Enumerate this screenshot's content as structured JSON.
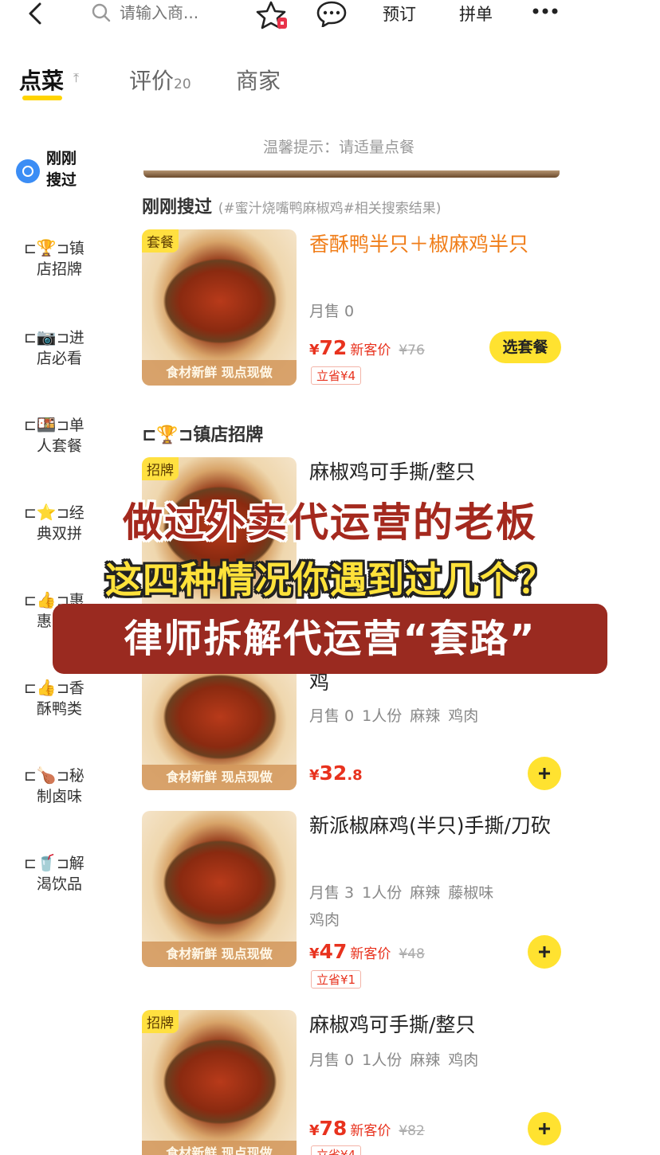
{
  "topbar": {
    "search_placeholder": "请输入商...",
    "preorder": "预订",
    "group_order": "拼单"
  },
  "tabs": [
    {
      "label": "点菜"
    },
    {
      "label": "评价",
      "count": "20"
    },
    {
      "label": "商家"
    }
  ],
  "sidebar": {
    "recent": "刚刚搜过",
    "items": [
      {
        "emoji": "🏆",
        "label_a": "⊏",
        "label_b": "⊐镇",
        "label_c": "店招牌"
      },
      {
        "emoji": "📷",
        "label_a": "⊏",
        "label_b": "⊐进",
        "label_c": "店必看"
      },
      {
        "emoji": "🍱",
        "label_a": "⊏",
        "label_b": "⊐单",
        "label_c": "人套餐"
      },
      {
        "emoji": "⭐",
        "label_a": "⊏",
        "label_b": "⊐经",
        "label_c": "典双拼"
      },
      {
        "emoji": "👍",
        "label_a": "⊏",
        "label_b": "⊐惠",
        "label_c": "惠"
      },
      {
        "emoji": "👍",
        "label_a": "⊏",
        "label_b": "⊐香",
        "label_c": "酥鸭类"
      },
      {
        "emoji": "🍗",
        "label_a": "⊏",
        "label_b": "⊐秘",
        "label_c": "制卤味"
      },
      {
        "emoji": "🥤",
        "label_a": "⊏",
        "label_b": "⊐解",
        "label_c": "渴饮品"
      }
    ]
  },
  "main": {
    "hint": "温馨提示：请适量点餐",
    "recent_title": "刚刚搜过",
    "recent_sub": "(#蜜汁烧嘴鸭麻椒鸡#相关搜索结果)",
    "section2_title": "⊏🏆⊐镇店招牌",
    "thumb_strip": "食材新鲜 现点现做",
    "items": [
      {
        "tag": "套餐",
        "name": "香酥鸭半只＋椒麻鸡半只",
        "meta": [
          "月售 0"
        ],
        "price_symbol": "¥",
        "price": "72",
        "new_label": "新客价",
        "old_price": "¥76",
        "save": "立省¥4",
        "button": "选套餐"
      },
      {
        "tag": "招牌",
        "name": "麻椒鸡可手撕/整只",
        "meta": []
      },
      {
        "name": "鸡",
        "meta": [
          "月售 0",
          "1人份",
          "麻辣",
          "鸡肉"
        ],
        "price_symbol": "¥",
        "price": "32",
        "price_decimal": ".8"
      },
      {
        "name": "新派椒麻鸡(半只)手撕/刀砍",
        "meta": [
          "月售 3",
          "1人份",
          "麻辣",
          "藤椒味"
        ],
        "meta2": "鸡肉",
        "price_symbol": "¥",
        "price": "47",
        "new_label": "新客价",
        "old_price": "¥48",
        "save": "立省¥1"
      },
      {
        "tag": "招牌",
        "name": "麻椒鸡可手撕/整只",
        "meta": [
          "月售 0",
          "1人份",
          "麻辣",
          "鸡肉"
        ],
        "price_symbol": "¥",
        "price": "78",
        "new_label": "新客价",
        "old_price": "¥82",
        "save": "立省¥4"
      }
    ]
  },
  "overlay": {
    "line1": "做过外卖代运营的老板",
    "line2": "这四种情况你遇到过几个？",
    "line3": "律师拆解代运营“套路”"
  },
  "colors": {
    "accent_yellow": "#ffe230",
    "price_red": "#e8321e",
    "combo_orange": "#f07d18",
    "banner_red": "#9a2a20"
  }
}
